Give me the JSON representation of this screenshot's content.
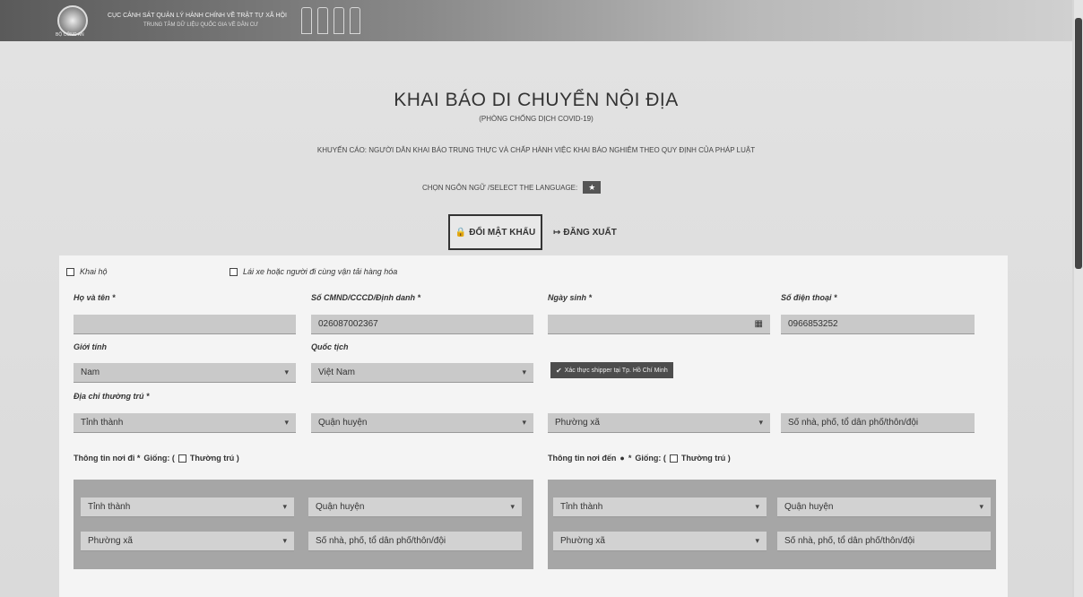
{
  "header": {
    "line1": "CỤC CẢNH SÁT QUẢN LÝ HÀNH CHÍNH VỀ TRẬT TỰ XÃ HỘI",
    "line2": "TRUNG TÂM DỮ LIỆU QUỐC GIA VỀ DÂN CƯ",
    "emblem_label": "BỘ CÔNG AN"
  },
  "page": {
    "title": "KHAI BÁO DI CHUYỂN NỘI ĐỊA",
    "subtitle": "(PHÒNG CHỐNG DỊCH COVID-19)",
    "advisory": "KHUYẾN CÁO: NGƯỜI DÂN KHAI BÁO TRUNG THỰC VÀ CHẤP HÀNH VIỆC KHAI BÁO NGHIÊM THEO QUY ĐỊNH CỦA PHÁP LUẬT",
    "language_label": "CHỌN NGÔN NGỮ /SELECT THE LANGUAGE:",
    "language_flag": "★"
  },
  "actions": {
    "change_password": "ĐỔI MẬT KHẨU",
    "logout": "ĐĂNG XUẤT"
  },
  "form": {
    "declare_for_others": "Khai hộ",
    "driver_option": "Lái xe hoặc người đi cùng vận tải hàng hóa",
    "name_label": "Họ và tên *",
    "name_value": "",
    "id_label": "Số CMND/CCCD/Định danh *",
    "id_value": "026087002367",
    "dob_label": "Ngày sinh *",
    "dob_value": "",
    "phone_label": "Số điện thoại *",
    "phone_value": "0966853252",
    "gender_label": "Giới tính",
    "gender_value": "Nam",
    "nationality_label": "Quốc tịch",
    "nationality_value": "Việt Nam",
    "shipper_button": "Xác thực shipper tại Tp. Hồ Chí Minh",
    "address_label": "Địa chỉ thường trú *",
    "province_placeholder": "Tỉnh thành",
    "district_placeholder": "Quận huyện",
    "ward_placeholder": "Phường xã",
    "street_placeholder": "Số nhà, phố, tổ dân phố/thôn/đội",
    "origin_label": "Thông tin nơi đi *",
    "destination_label": "Thông tin nơi đến",
    "same_as": "Giống: (",
    "permanent_option": "Thường trú )"
  }
}
